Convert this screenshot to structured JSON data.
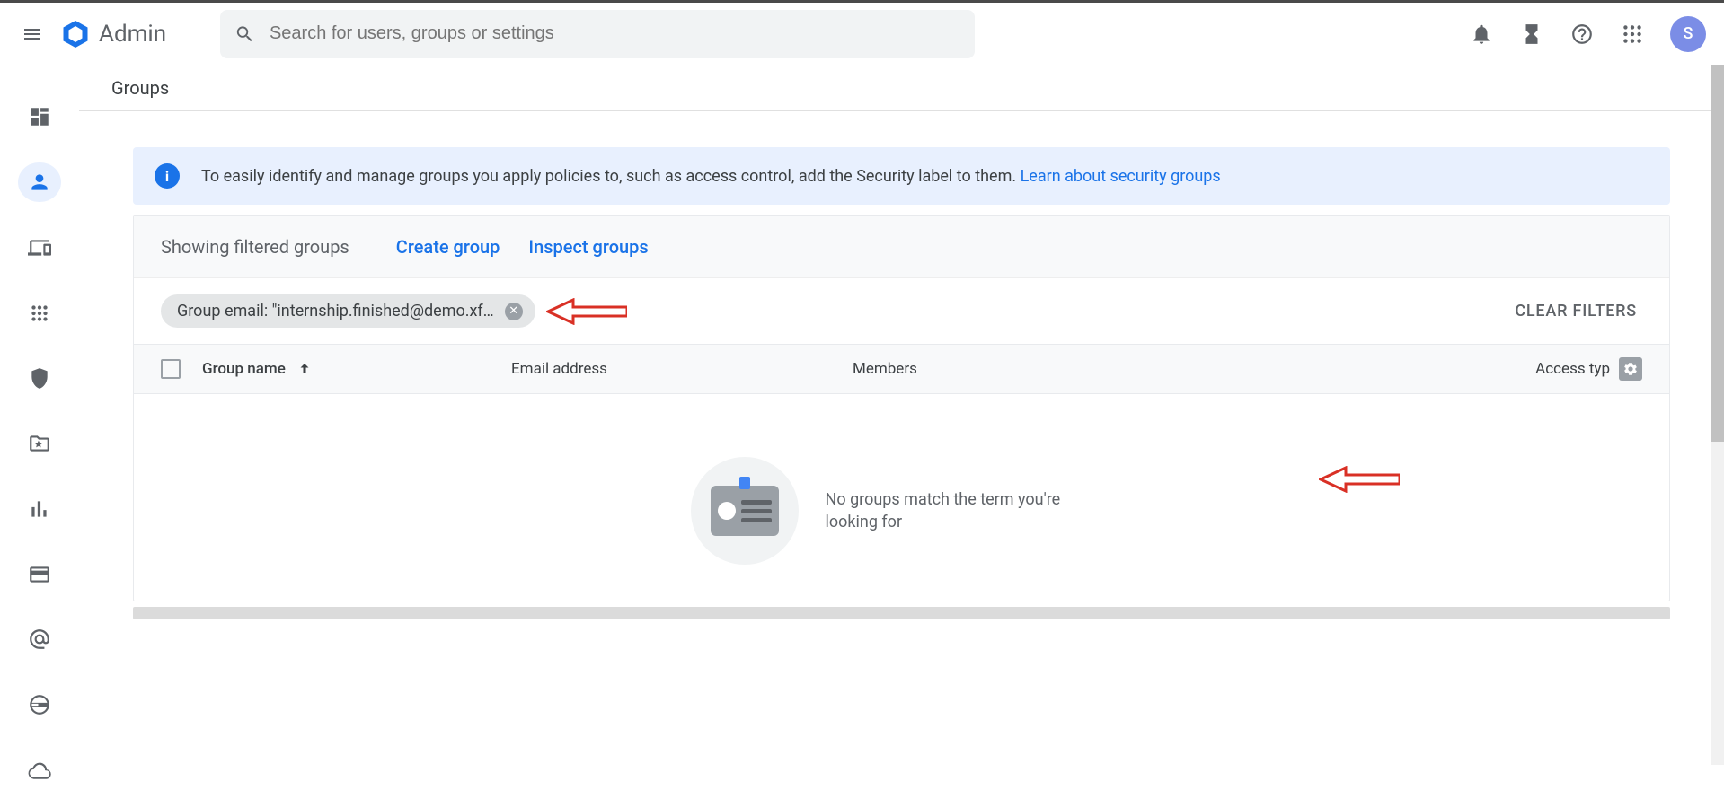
{
  "header": {
    "app_name": "Admin",
    "search_placeholder": "Search for users, groups or settings",
    "avatar_initial": "S"
  },
  "breadcrumb": {
    "page": "Groups"
  },
  "banner": {
    "text": "To easily identify and manage groups you apply policies to, such as access control, add the Security label to them. ",
    "link_text": "Learn about security groups"
  },
  "toolbar": {
    "heading": "Showing filtered groups",
    "create_label": "Create group",
    "inspect_label": "Inspect groups"
  },
  "filters": {
    "chip_text": "Group email: \"internship.finished@demo.xf…",
    "clear_label": "CLEAR FILTERS"
  },
  "table": {
    "columns": {
      "name": "Group name",
      "email": "Email address",
      "members": "Members",
      "access": "Access typ"
    }
  },
  "empty": {
    "message": "No groups match the term you're looking for"
  }
}
